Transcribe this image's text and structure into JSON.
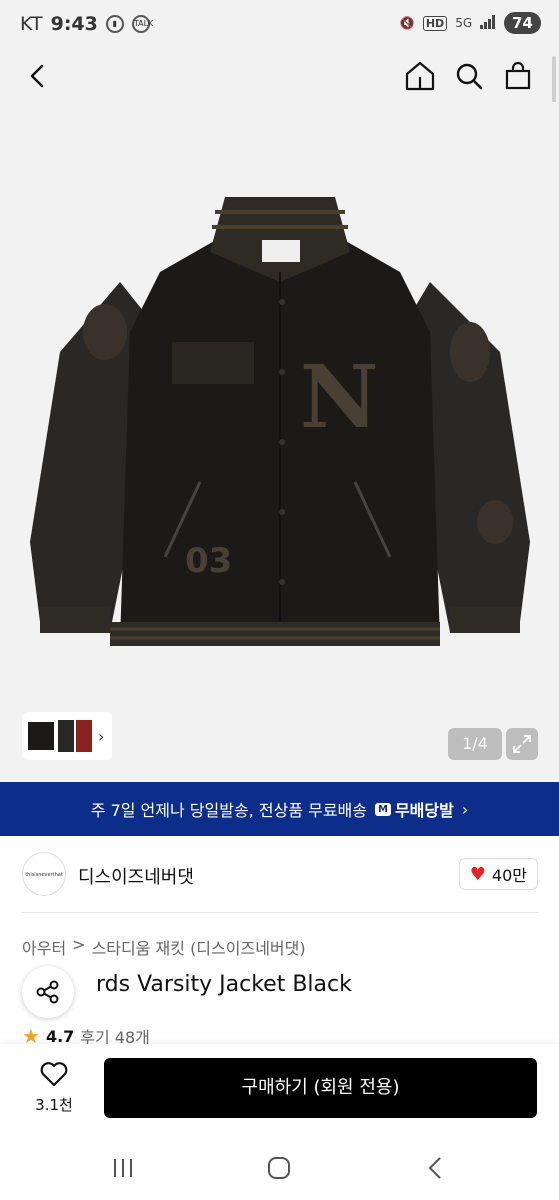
{
  "status": {
    "carrier": "KT",
    "time": "9:43",
    "talk_label": "TALK",
    "hd_label": "HD",
    "network": "5G",
    "battery": "74"
  },
  "gallery": {
    "counter": "1/4",
    "patch_letter": "N",
    "patch_number": "03"
  },
  "banner": {
    "text": "주 7일 언제나 당일발송, 전상품 무료배송",
    "badge": "M",
    "tag": "무배당발",
    "chevron": "›"
  },
  "brand": {
    "logo_text": "thisisneverthat",
    "name": "디스이즈네버댓",
    "likes": "40만"
  },
  "breadcrumb": {
    "category": "아우터",
    "separator": ">",
    "subcategory": "스타디움 재킷 (디스이즈네버댓)"
  },
  "product": {
    "title": "rds Varsity Jacket Black",
    "rating": "4.7",
    "reviews": "후기 48개"
  },
  "bottom": {
    "wish_count": "3.1천",
    "buy_label": "구매하기 (회원 전용)"
  },
  "colors": {
    "banner_bg": "#0d2d8a",
    "heart": "#e8212b",
    "star": "#f4a623",
    "buy_bg": "#000000"
  },
  "icons": [
    "back-icon",
    "home-icon",
    "search-icon",
    "bag-icon",
    "expand-icon",
    "share-icon",
    "heart-outline-icon",
    "recent-apps-icon",
    "home-circle-icon",
    "system-back-icon"
  ]
}
